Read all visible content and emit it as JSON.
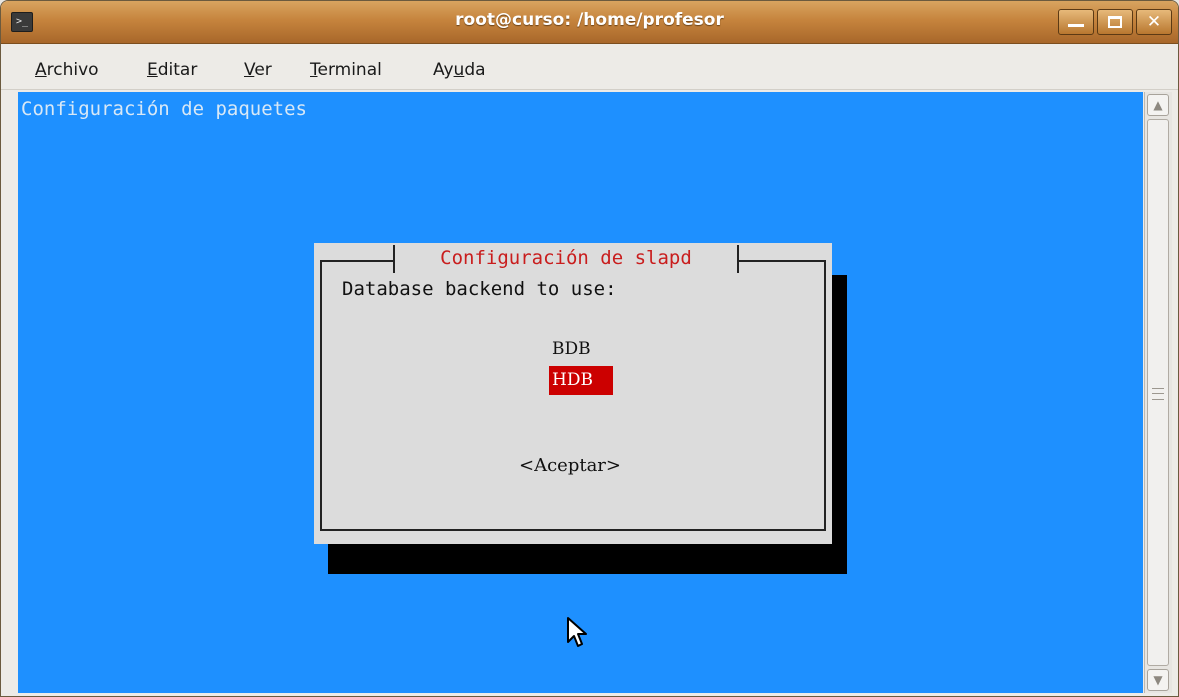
{
  "window": {
    "title": "root@curso: /home/profesor",
    "terminal_icon": "terminal-icon",
    "close_glyph": "✕"
  },
  "menubar": {
    "items": [
      {
        "pre": "",
        "mnemonic": "A",
        "post": "rchivo"
      },
      {
        "pre": "",
        "mnemonic": "E",
        "post": "ditar"
      },
      {
        "pre": "",
        "mnemonic": "V",
        "post": "er"
      },
      {
        "pre": "",
        "mnemonic": "T",
        "post": "erminal"
      },
      {
        "pre": "Ay",
        "mnemonic": "u",
        "post": "da"
      }
    ]
  },
  "terminal": {
    "header": "Configuración de paquetes",
    "background_color": "#1e90ff",
    "dialog": {
      "title": "Configuración de slapd",
      "prompt": "Database backend to use:",
      "options": [
        {
          "label": "BDB",
          "selected": false
        },
        {
          "label": "HDB",
          "selected": true
        }
      ],
      "ok_button": "<Aceptar>",
      "title_color": "#c91d1d",
      "selection_color": "#cc0000"
    }
  },
  "colors": {
    "titlebar": "#c6843d",
    "dialog_bg": "#dcdcdc",
    "shadow": "#000000"
  }
}
